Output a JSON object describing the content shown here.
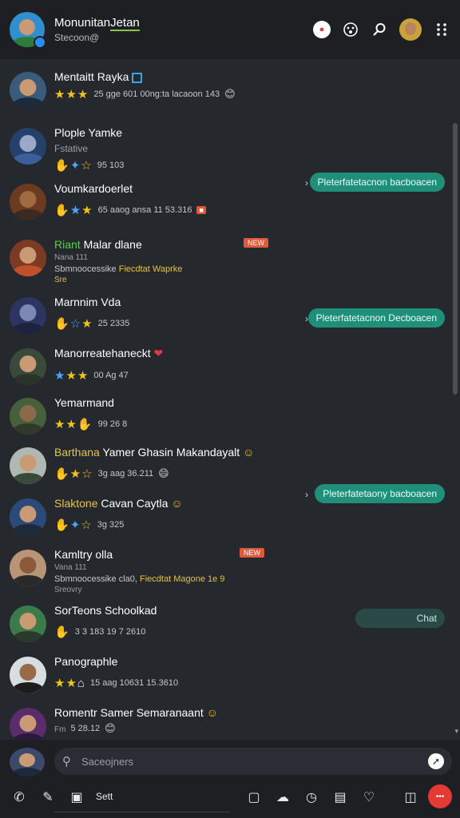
{
  "header": {
    "title": "Monunitan",
    "title_underlined": "Jetan",
    "subtitle": "Stecoon@",
    "icons": [
      "record-icon",
      "paw-icon",
      "search-icon",
      "user-avatar",
      "menu-icon"
    ],
    "record_label": "●"
  },
  "list": {
    "rows": [
      {
        "name": "Mentaitt Rayka",
        "meta": "25 gge 601 00ng:ta lacaoon 143",
        "avatar_bg": "#3b5b7a"
      },
      {
        "name": "Plople Yamke",
        "sub": "Fstative",
        "meta": "95 103",
        "avatar_bg": "#25406b"
      },
      {
        "name": "Voumkardoerlet",
        "meta": "65 aaog ansa 11 53.316",
        "avatar_bg": "#6b3a1f"
      },
      {
        "name_accent": "Riant",
        "name": "Malar dlane",
        "sub": "Nana 111",
        "desc": "Sbmnoocessike",
        "desc_accent": "Fiecdtat Waprke",
        "small": "Sre",
        "badge": "NEW",
        "avatar_bg": "#7a3a24"
      },
      {
        "name": "Marnnim Vda",
        "meta": "25 2335",
        "avatar_bg": "#2c3560"
      },
      {
        "name": "Manorreatehaneckt",
        "meta": "00 Ag 47",
        "avatar_bg": "#3a4a3a"
      },
      {
        "name": "Yemarmand",
        "meta": "99 26 8",
        "avatar_bg": "#45603a"
      },
      {
        "name_accent": "Barthana",
        "name": "Yamer Ghasin Makandayalt",
        "meta": "3g aag 36.211",
        "avatar_bg": "#b0b8b4"
      },
      {
        "name_accent": "Slaktone",
        "name": "Cavan Caytla",
        "meta": "3g 325",
        "avatar_bg": "#2b4a7a"
      },
      {
        "name": "Kamltry olla",
        "sub": "Vana 111",
        "desc": "Sbmnoocessike cla0,",
        "desc_accent": "Fiecdtat Magone 1e 9",
        "small": "Sreovry",
        "badge": "NEW",
        "avatar_bg": "#b89478"
      },
      {
        "name": "SorTeons Schoolkad",
        "meta": "3 3 183 19 7 2610",
        "avatar_bg": "#3b7a4a"
      },
      {
        "name": "Panographle",
        "meta": "15 aag 10631 15.3610",
        "avatar_bg": "#d8dde2"
      },
      {
        "name": "Romentr Samer Semaranaant",
        "sub": "Fm",
        "meta": "5 28.12",
        "avatar_bg": "#5a2c6b"
      }
    ],
    "pills": [
      {
        "label": "Pleterfatetacnon bacboacen"
      },
      {
        "label": "Pleterfatetacnon Decboacen"
      },
      {
        "label": "Pleterfatetaony bacboacen"
      },
      {
        "label": "Chat"
      }
    ]
  },
  "composer": {
    "search_placeholder": "Saceojners",
    "toolbar_label": "Sett",
    "fab_label": "•••"
  },
  "colors": {
    "background": "#25282d",
    "header": "#1d1f23",
    "pill": "#1f8f7a",
    "star": "#f0c419",
    "badge": "#e0593a",
    "fab": "#e53935"
  }
}
